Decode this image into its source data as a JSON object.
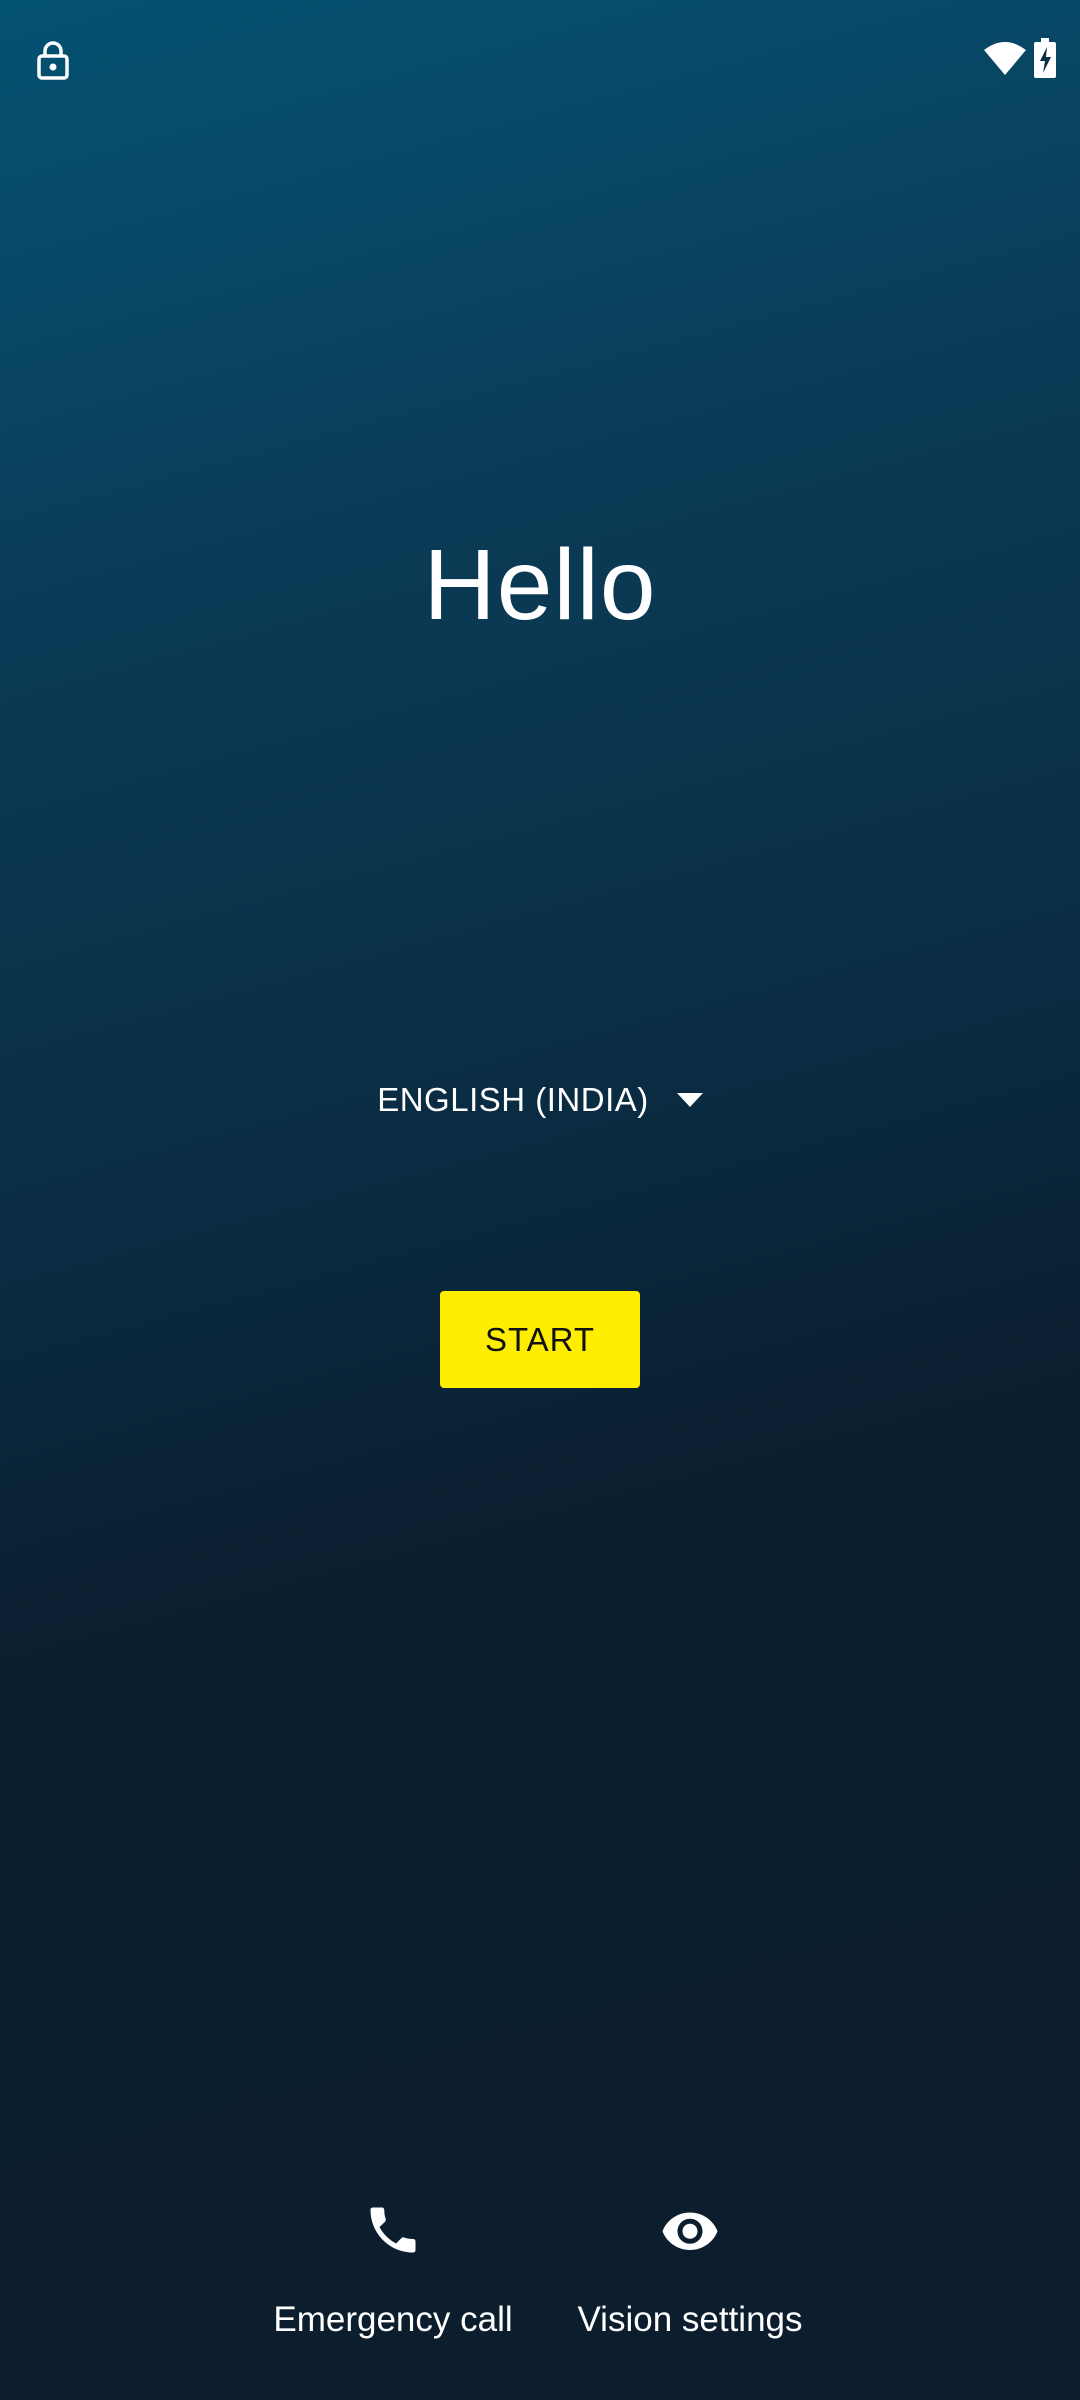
{
  "status_bar": {
    "left_icon": "lock-icon",
    "right_icons": [
      "wifi-icon",
      "battery-charging-icon"
    ]
  },
  "welcome": {
    "title": "Hello"
  },
  "language": {
    "selected": "ENGLISH (INDIA)",
    "icon": "caret-down-icon"
  },
  "actions": {
    "start_label": "START",
    "emergency_label": "Emergency call",
    "emergency_icon": "phone-icon",
    "vision_label": "Vision settings",
    "vision_icon": "eye-icon"
  },
  "colors": {
    "background_top": "#045273",
    "background_bottom": "#0c1e2d",
    "start_button": "#ffee00",
    "text": "#ffffff"
  }
}
